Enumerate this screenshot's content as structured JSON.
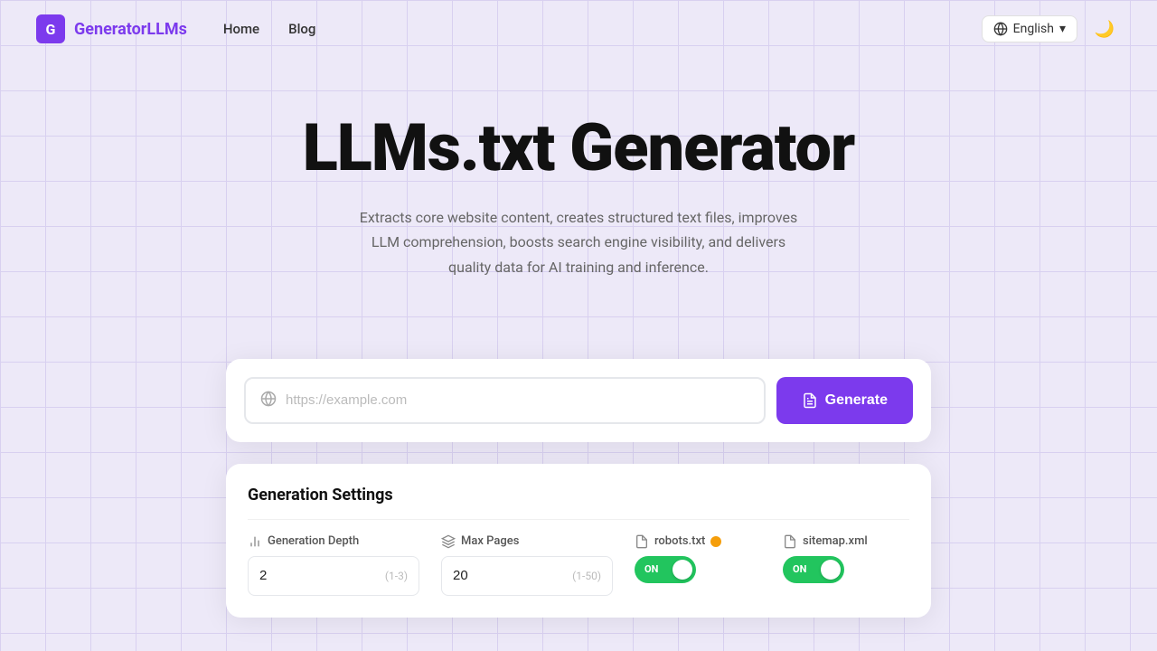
{
  "brand": {
    "icon_letter": "G",
    "name": "GeneratorLLMs"
  },
  "nav": {
    "links": [
      {
        "label": "Home",
        "href": "#"
      },
      {
        "label": "Blog",
        "href": "#"
      }
    ],
    "language": "English",
    "language_chevron": "▾"
  },
  "hero": {
    "title": "LLMs.txt Generator",
    "subtitle": "Extracts core website content, creates structured text files, improves LLM comprehension, boosts search engine visibility, and delivers quality data for AI training and inference."
  },
  "url_input": {
    "placeholder": "https://example.com"
  },
  "generate_button": {
    "label": "Generate"
  },
  "settings": {
    "title": "Generation Settings",
    "depth": {
      "label": "Generation Depth",
      "value": "2",
      "range": "(1-3)"
    },
    "max_pages": {
      "label": "Max Pages",
      "value": "20",
      "range": "(1-50)"
    },
    "robots": {
      "label": "robots.txt",
      "state": "ON"
    },
    "sitemap": {
      "label": "sitemap.xml",
      "state": "ON"
    }
  }
}
